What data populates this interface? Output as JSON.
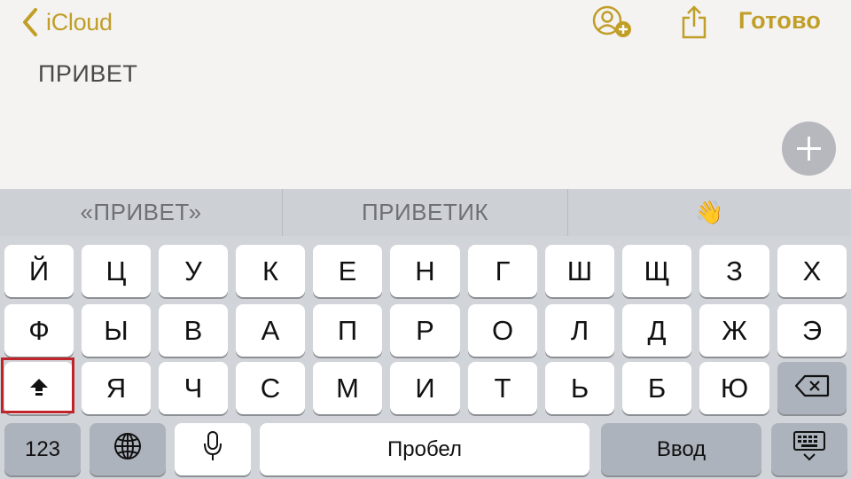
{
  "nav": {
    "back_label": "iCloud",
    "done_label": "Готово",
    "accent_color": "#c09e27",
    "icons": [
      "chevron-left-icon",
      "add-contact-icon",
      "share-icon"
    ]
  },
  "note": {
    "text": "ПРИВЕТ",
    "add_button_icon": "plus-icon"
  },
  "keyboard": {
    "suggestions": [
      "«ПРИВЕТ»",
      "ПРИВЕТИК",
      "👋"
    ],
    "rows": [
      [
        "Й",
        "Ц",
        "У",
        "К",
        "Е",
        "Н",
        "Г",
        "Ш",
        "Щ",
        "З",
        "Х"
      ],
      [
        "Ф",
        "Ы",
        "В",
        "А",
        "П",
        "Р",
        "О",
        "Л",
        "Д",
        "Ж",
        "Э"
      ],
      [
        "Я",
        "Ч",
        "С",
        "М",
        "И",
        "Т",
        "Ь",
        "Б",
        "Ю"
      ]
    ],
    "numbers_label": "123",
    "space_label": "Пробел",
    "return_label": "Ввод",
    "shift_icon": "shift-icon",
    "delete_icon": "backspace-icon",
    "globe_icon": "globe-icon",
    "mic_icon": "microphone-icon",
    "dismiss_icon": "keyboard-dismiss-icon",
    "highlight_color": "#c0242b"
  }
}
